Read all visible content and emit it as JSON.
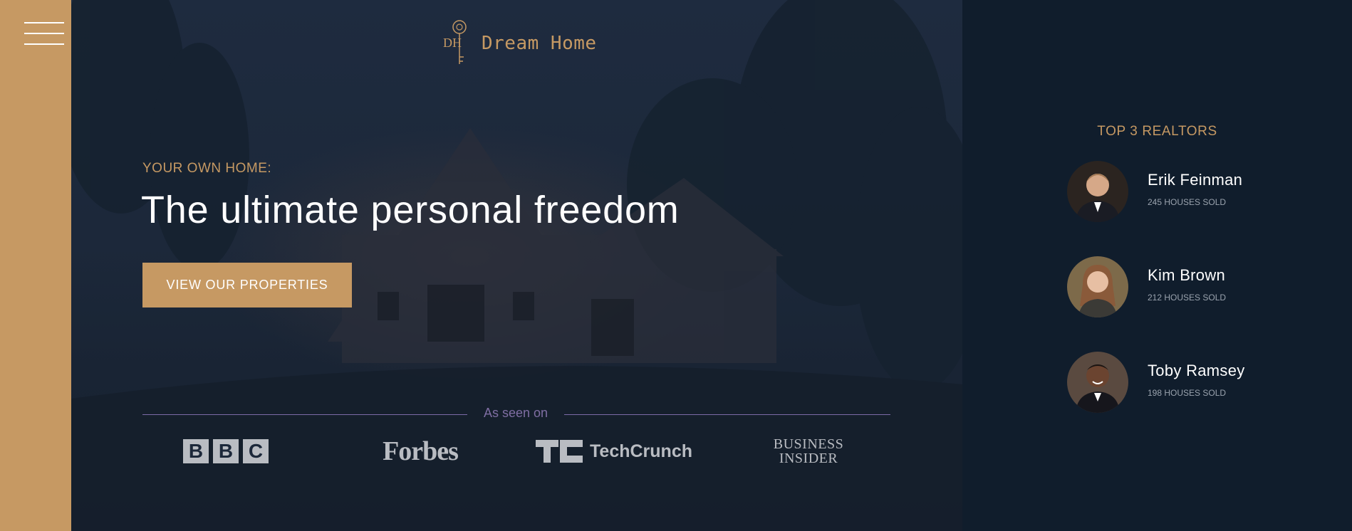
{
  "brand": {
    "name": "Dream Home",
    "mark_letters": "DH"
  },
  "hero": {
    "eyebrow": "YOUR OWN HOME:",
    "headline": "The ultimate personal freedom",
    "cta_label": "VIEW OUR PROPERTIES"
  },
  "seen_on": {
    "label": "As seen on",
    "logos": [
      {
        "name": "BBC",
        "letters": [
          "B",
          "B",
          "C"
        ]
      },
      {
        "name": "Forbes",
        "text": "Forbes"
      },
      {
        "name": "TechCrunch",
        "text": "TechCrunch"
      },
      {
        "name": "Business Insider",
        "line1": "BUSINESS",
        "line2": "INSIDER"
      }
    ]
  },
  "realtors": {
    "title": "TOP 3 REALTORS",
    "items": [
      {
        "name": "Erik Feinman",
        "sold": "245 HOUSES SOLD"
      },
      {
        "name": "Kim Brown",
        "sold": "212 HOUSES SOLD"
      },
      {
        "name": "Toby Ramsey",
        "sold": "198 HOUSES SOLD"
      }
    ]
  },
  "colors": {
    "primary": "#c69963",
    "dark": "#101d2c",
    "accent_line": "#7c6aa8",
    "white": "#ffffff"
  },
  "icons": {
    "menu": "hamburger-menu-icon",
    "logo": "key-logo-icon"
  }
}
